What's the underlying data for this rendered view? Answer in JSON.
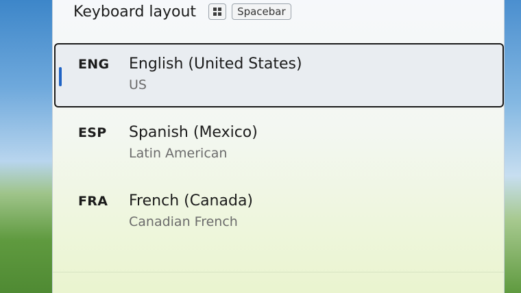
{
  "header": {
    "title": "Keyboard layout",
    "shortcut_space": "Spacebar"
  },
  "layouts": [
    {
      "code": "ENG",
      "name": "English (United States)",
      "layout": "US",
      "selected": true
    },
    {
      "code": "ESP",
      "name": "Spanish (Mexico)",
      "layout": "Latin American",
      "selected": false
    },
    {
      "code": "FRA",
      "name": "French (Canada)",
      "layout": "Canadian French",
      "selected": false
    }
  ],
  "colors": {
    "accent": "#1f63c4",
    "selected_border": "#1a1a1a"
  }
}
